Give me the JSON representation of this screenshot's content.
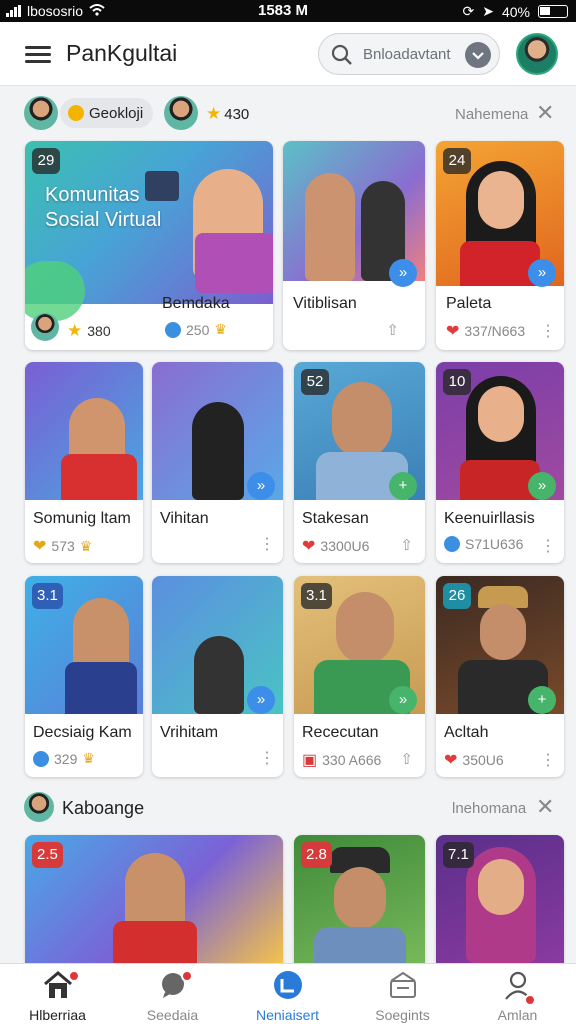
{
  "status_bar": {
    "carrier": "lbososrio",
    "time": "1583 M",
    "battery": "40%"
  },
  "header": {
    "title": "PanKgultai",
    "search_placeholder": "Bnloadavtant"
  },
  "section1": {
    "chip_label": "Geokloji",
    "rating": "430",
    "label": "Nahemena"
  },
  "section2": {
    "title": "Kaboange",
    "label": "lnehomana"
  },
  "cards": [
    {
      "badge": "29",
      "banner_text": "Komunitas Sosial Virtual",
      "title": "Bemdaka",
      "rating": "380",
      "meta": "250"
    },
    {
      "title": "Vitiblisan"
    },
    {
      "badge": "24",
      "title": "Paleta",
      "meta": "337/N663"
    },
    {
      "title": "Somunig ltam",
      "meta": "573"
    },
    {
      "title": "Vihitan"
    },
    {
      "badge": "52",
      "title": "Stakesan",
      "meta": "3300U6"
    },
    {
      "badge": "10",
      "title": "Keenuirllasis",
      "meta": "S71U636"
    },
    {
      "badge": "3.1",
      "title": "Decsiaig Kam",
      "meta": "329"
    },
    {
      "title": "Vrihitam"
    },
    {
      "badge": "3.1",
      "title": "Rececutan",
      "meta": "330 A666"
    },
    {
      "badge": "26",
      "title": "Acltah",
      "meta": "350U6"
    },
    {
      "badge": "2.5"
    },
    {
      "badge": "2.8"
    },
    {
      "badge": "7.1"
    }
  ],
  "bottom_nav": [
    {
      "label": "Hlberriaa"
    },
    {
      "label": "Seedaia"
    },
    {
      "label": "Neniaisert"
    },
    {
      "label": "Soegints"
    },
    {
      "label": "Amlan"
    }
  ],
  "colors": {
    "accent": "#2a7bd8",
    "like": "#e23b3b",
    "star": "#f2b705"
  }
}
